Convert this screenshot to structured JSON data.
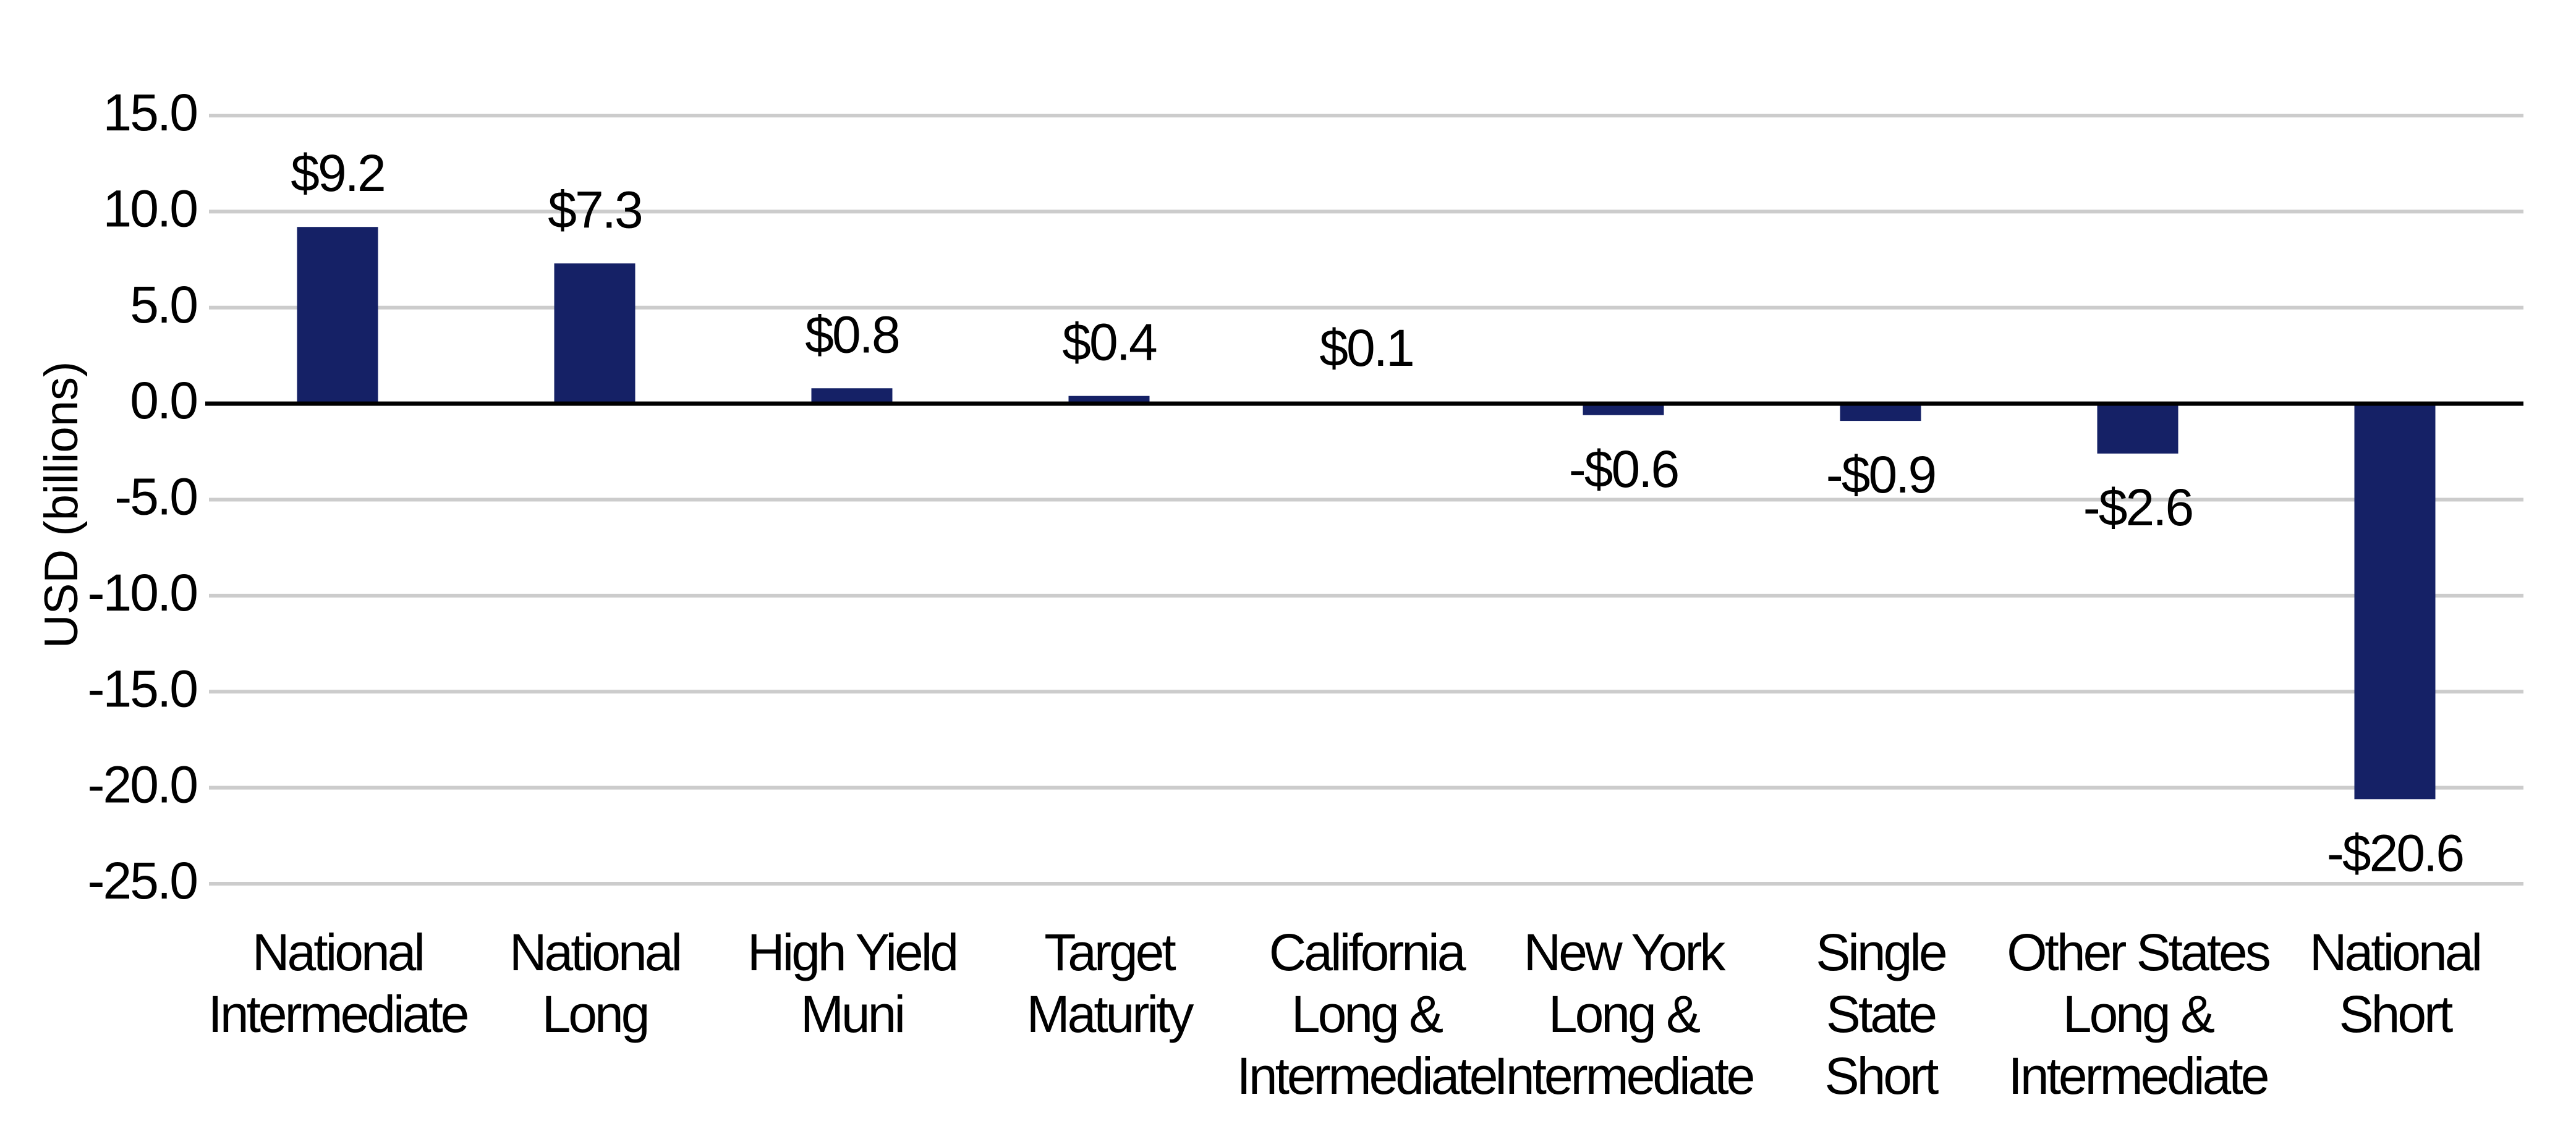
{
  "chart_data": {
    "type": "bar",
    "title": "",
    "xlabel": "",
    "ylabel": "USD (billions)",
    "ylim": [
      -25,
      15
    ],
    "yticks": [
      15,
      10,
      5,
      0,
      -5,
      -10,
      -15,
      -20,
      -25
    ],
    "ytick_labels": [
      "15.0",
      "10.0",
      "5.0",
      "0.0",
      "-5.0",
      "-10.0",
      "-15.0",
      "-20.0",
      "-25.0"
    ],
    "grid": true,
    "legend": "none",
    "categories": [
      [
        "National",
        "Intermediate"
      ],
      [
        "National",
        "Long"
      ],
      [
        "High Yield",
        "Muni"
      ],
      [
        "Target",
        "Maturity"
      ],
      [
        "California",
        "Long &",
        "Intermediate"
      ],
      [
        "New York",
        "Long &",
        "Intermediate"
      ],
      [
        "Single",
        "State",
        "Short"
      ],
      [
        "Other States",
        "Long &",
        "Intermediate"
      ],
      [
        "National",
        "Short"
      ]
    ],
    "values": [
      9.2,
      7.3,
      0.8,
      0.4,
      0.1,
      -0.6,
      -0.9,
      -2.6,
      -20.6
    ],
    "data_labels": [
      "$9.2",
      "$7.3",
      "$0.8",
      "$0.4",
      "$0.1",
      "-$0.6",
      "-$0.9",
      "-$2.6",
      "-$20.6"
    ],
    "colors": {
      "bar": "#152166",
      "grid": "#cccccc",
      "zero_line": "#000000",
      "text": "#000000"
    }
  }
}
